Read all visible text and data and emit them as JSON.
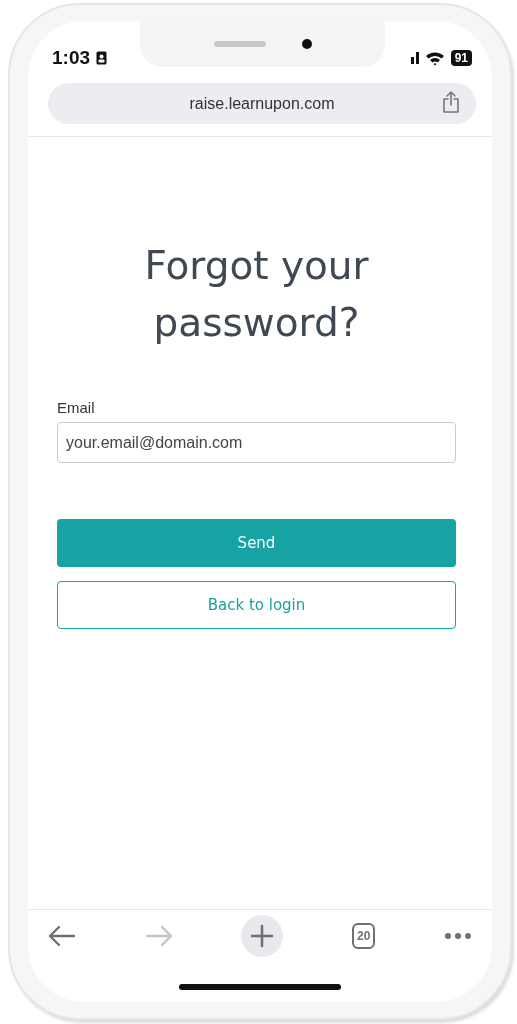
{
  "status_bar": {
    "time": "1:03",
    "battery": "91"
  },
  "address_bar": {
    "url": "raise.learnupon.com"
  },
  "heading": "Forgot your password?",
  "email_field": {
    "label": "Email",
    "placeholder": "your.email@domain.com"
  },
  "buttons": [
    {
      "label": "Send",
      "kind": "primary"
    },
    {
      "label": "Back to login",
      "kind": "secondary"
    }
  ],
  "toolbar": [
    {
      "kind": "back",
      "disabled": false
    },
    {
      "kind": "forward",
      "disabled": true
    },
    {
      "kind": "new-tab",
      "disabled": false
    },
    {
      "kind": "tabs",
      "label": "20",
      "disabled": false
    },
    {
      "kind": "more",
      "disabled": false
    }
  ]
}
